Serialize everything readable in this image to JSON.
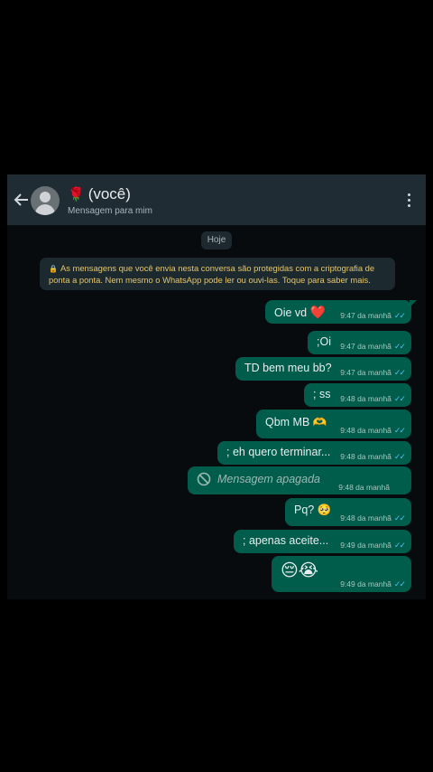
{
  "header": {
    "title": "(você)",
    "subtitle": "Mensagem para mim"
  },
  "date_divider": "Hoje",
  "encryption_notice": "As mensagens que você envia nesta conversa são protegidas com a criptografia de ponta a ponta. Nem mesmo o WhatsApp pode ler ou ouvi-las. Toque para saber mais.",
  "messages": [
    {
      "text": "Oie vd",
      "emoji": "❤️",
      "time": "9:47 da manhã"
    },
    {
      "text": ";Oi",
      "time": "9:47 da manhã"
    },
    {
      "text": "TD bem meu bb?",
      "time": "9:47 da manhã"
    },
    {
      "text": "; ss",
      "time": "9:48 da manhã"
    },
    {
      "text": "Qbm MB",
      "emoji": "🫶",
      "time": "9:48 da manhã"
    },
    {
      "text": "; eh quero terminar...",
      "time": "9:48 da manhã"
    },
    {
      "text": "Mensagem apagada",
      "time": "9:48 da manhã",
      "deleted": true
    },
    {
      "text": "Pq?",
      "emoji": "🥺",
      "time": "9:48 da manhã"
    },
    {
      "text": "; apenas aceite...",
      "time": "9:49 da manhã"
    },
    {
      "text": "",
      "emoji": "😔😭",
      "time": "9:49 da manhã"
    }
  ],
  "ticks": "✓✓",
  "colors": {
    "header_bg": "#1f2c34",
    "bubble_out": "#005c4b",
    "tick_read": "#53bdeb",
    "notice_text": "#e6c56a"
  }
}
